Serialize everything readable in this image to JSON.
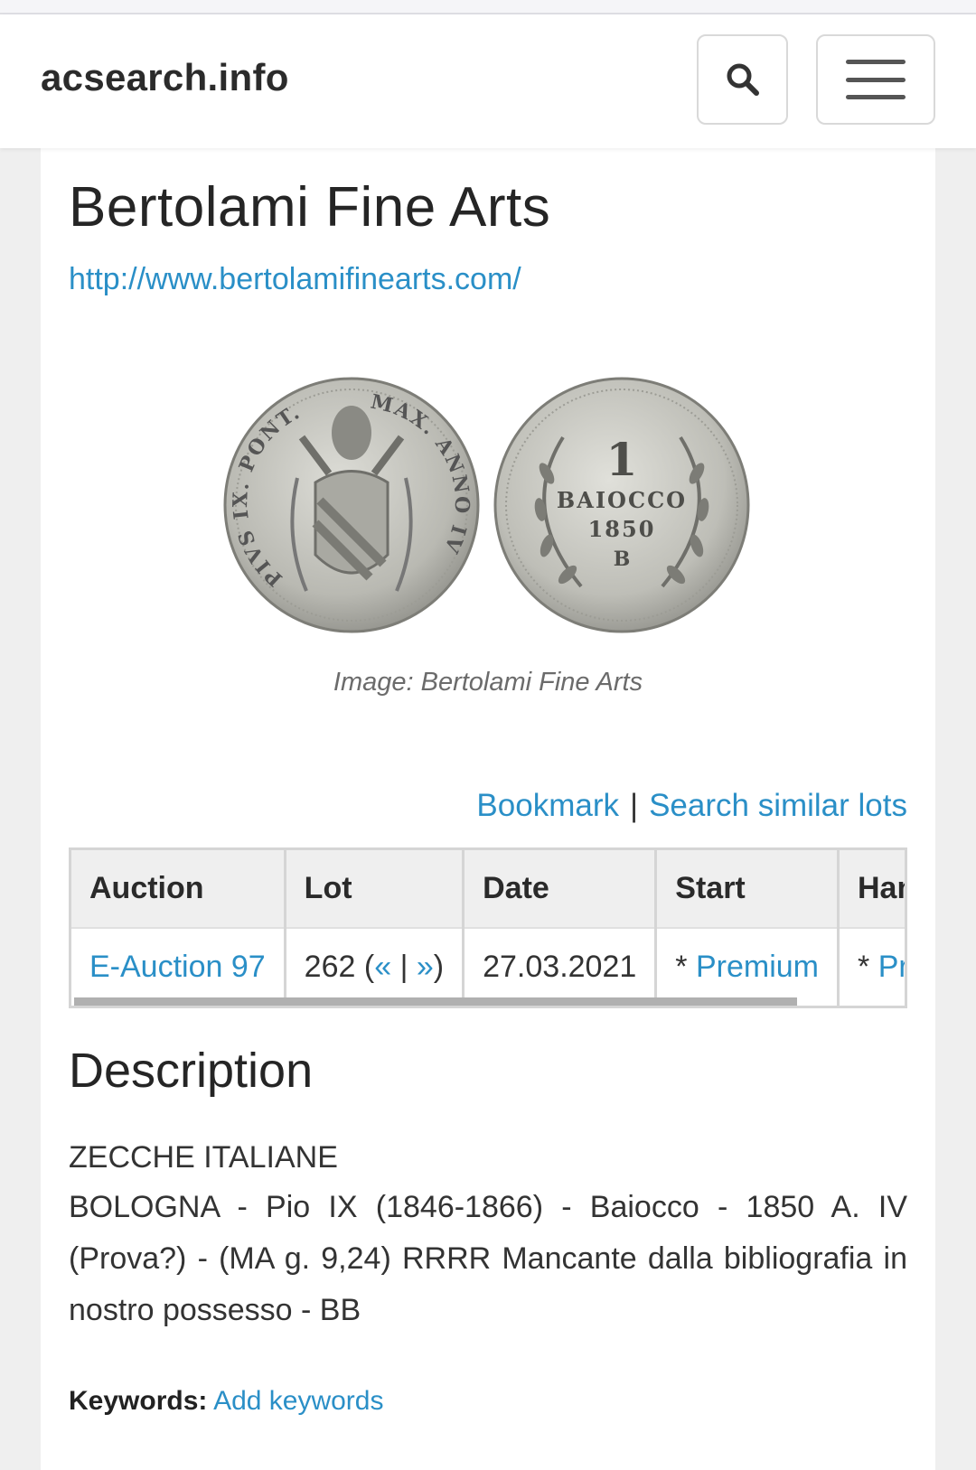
{
  "navbar": {
    "brand": "acsearch.info",
    "search_icon": "search-icon",
    "menu_icon": "hamburger-menu-icon"
  },
  "auction_house": {
    "title": "Bertolami Fine Arts",
    "url": "http://www.bertolamifinearts.com/"
  },
  "image": {
    "caption": "Image: Bertolami Fine Arts",
    "obverse_legend_left": "PIVS IX. PONT.",
    "obverse_legend_right": "MAX. ANNO IV",
    "reverse_value": "1",
    "reverse_denomination": "BAIOCCO",
    "reverse_year": "1850",
    "reverse_mint": "B"
  },
  "actions": {
    "bookmark": "Bookmark",
    "separator": "|",
    "search_similar": "Search similar lots"
  },
  "table": {
    "headers": [
      "Auction",
      "Lot",
      "Date",
      "Start",
      "Hammer"
    ],
    "row": {
      "auction": "E-Auction 97",
      "lot_number": "262",
      "lot_prev": "«",
      "lot_sep": "|",
      "lot_next": "»",
      "date": "27.03.2021",
      "start_prefix": "*",
      "start_link": "Premium",
      "hammer_prefix": "*",
      "hammer_link": "Premium"
    }
  },
  "description": {
    "heading": "Description",
    "category": "ZECCHE ITALIANE",
    "text": "BOLOGNA - Pio IX (1846-1866) - Baiocco - 1850 A. IV (Prova?) - (MA g. 9,24) RRRR Mancante dalla bibliografia in nostro possesso - BB"
  },
  "keywords": {
    "label": "Keywords:",
    "add_link": "Add keywords"
  },
  "colors": {
    "link": "#2a8fc7",
    "background": "#efefef",
    "card": "#ffffff"
  }
}
